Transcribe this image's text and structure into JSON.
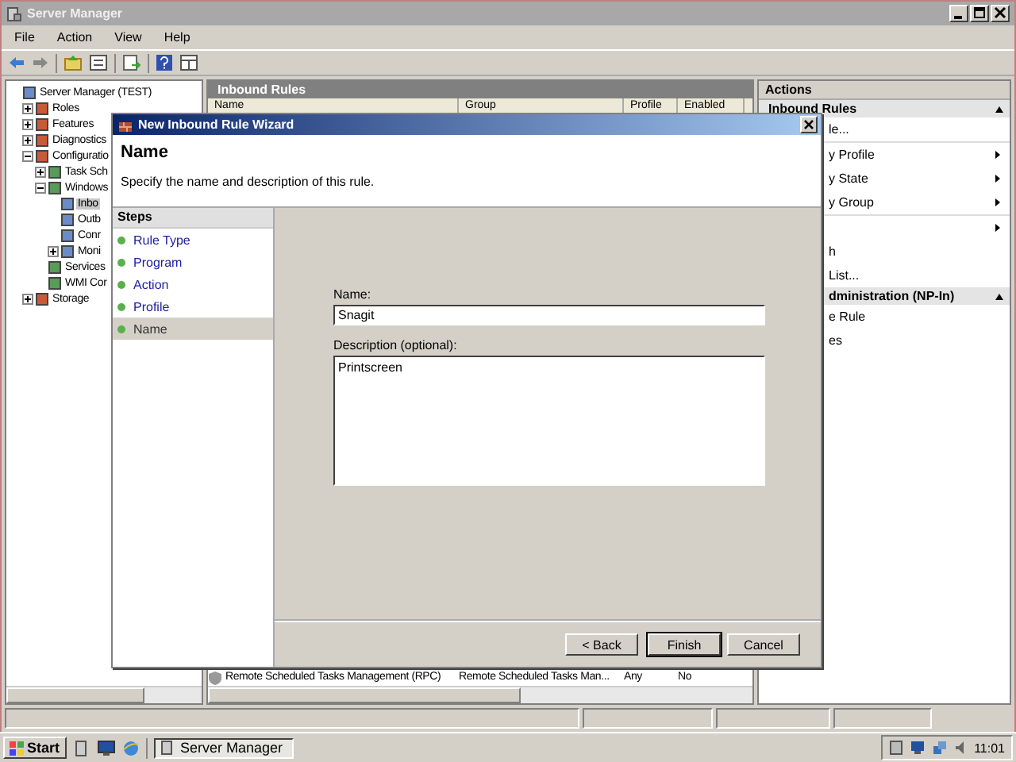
{
  "window": {
    "title": "Server Manager"
  },
  "menu": [
    "File",
    "Action",
    "View",
    "Help"
  ],
  "tree": [
    {
      "label": "Server Manager (TEST)",
      "selected": false,
      "children": [
        {
          "label": "Roles",
          "expanded": false,
          "selected": false
        },
        {
          "label": "Features",
          "expanded": false,
          "selected": false
        },
        {
          "label": "Diagnostics",
          "expanded": false,
          "selected": false
        },
        {
          "label": "Configuratio",
          "expanded": true,
          "selected": false,
          "children": [
            {
              "label": "Task Sch",
              "expanded": false,
              "selected": false
            },
            {
              "label": "Windows",
              "expanded": true,
              "selected": false,
              "children": [
                {
                  "label": "Inbo",
                  "selected": true
                },
                {
                  "label": "Outb",
                  "selected": false
                },
                {
                  "label": "Conr",
                  "selected": false
                },
                {
                  "label": "Moni",
                  "expanded": false,
                  "selected": false
                }
              ]
            },
            {
              "label": "Services",
              "selected": false
            },
            {
              "label": "WMI Cor",
              "selected": false
            }
          ]
        },
        {
          "label": "Storage",
          "expanded": false,
          "selected": false
        }
      ]
    }
  ],
  "rules": {
    "title": "Inbound Rules",
    "columns": [
      "Name",
      "Group",
      "Profile",
      "Enabled"
    ],
    "rows": [
      {
        "name": "Remote Scheduled Tasks Management (RPC)",
        "group": "Remote Scheduled Tasks Man...",
        "profile": "Any",
        "enabled": "No"
      }
    ]
  },
  "actions": {
    "title": "Actions",
    "sections": [
      {
        "title": "Inbound Rules",
        "items": [
          {
            "label": "le...",
            "submenu": false
          },
          {
            "label": "y Profile",
            "submenu": true
          },
          {
            "label": "y State",
            "submenu": true
          },
          {
            "label": "y Group",
            "submenu": true
          },
          {
            "submenu": true
          },
          {
            "label": "h",
            "submenu": false
          },
          {
            "label": "List...",
            "submenu": false
          }
        ]
      },
      {
        "title": "dministration (NP-In)",
        "items": [
          {
            "label": "e Rule",
            "submenu": false
          },
          {
            "label": "es",
            "submenu": false
          }
        ]
      }
    ]
  },
  "wizard": {
    "title": "New Inbound Rule Wizard",
    "heading": "Name",
    "subtitle": "Specify the name and description of this rule.",
    "steps_title": "Steps",
    "steps": [
      {
        "label": "Rule Type",
        "selected": false
      },
      {
        "label": "Program",
        "selected": false
      },
      {
        "label": "Action",
        "selected": false
      },
      {
        "label": "Profile",
        "selected": false
      },
      {
        "label": "Name",
        "selected": true
      }
    ],
    "name_label": "Name:",
    "name_value": "Snagit",
    "description_label": "Description (optional):",
    "description_value": "Printscreen",
    "buttons": [
      {
        "label": "< Back",
        "default": false
      },
      {
        "label": "Finish",
        "default": true
      },
      {
        "label": "Cancel",
        "default": false
      }
    ]
  },
  "taskbar": {
    "start": "Start",
    "tasks": [
      {
        "label": "Server Manager",
        "selected": true
      }
    ],
    "clock": "11:01"
  }
}
